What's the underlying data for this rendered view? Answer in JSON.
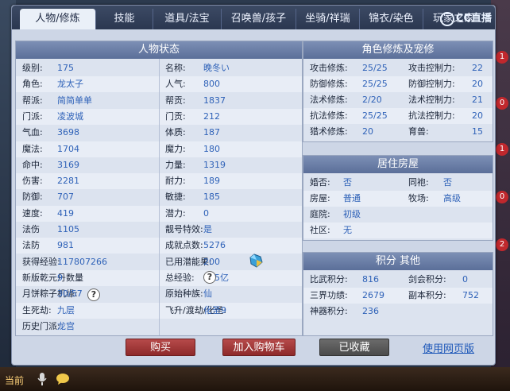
{
  "tabs": [
    "人物/修炼",
    "技能",
    "道具/法宝",
    "召唤兽/孩子",
    "坐骑/祥瑞",
    "锦衣/染色",
    "玩家之家"
  ],
  "logo": "CC直播",
  "char_status": {
    "title": "人物状态",
    "rows": [
      {
        "l1": "级别:",
        "v1": "175",
        "l2": "名称:",
        "v2": "晚冬い"
      },
      {
        "l1": "角色:",
        "v1": "龙太子",
        "l2": "人气:",
        "v2": "800"
      },
      {
        "l1": "帮派:",
        "v1": "简简单单",
        "l2": "帮贡:",
        "v2": "1837"
      },
      {
        "l1": "门派:",
        "v1": "凌波城",
        "l2": "门贡:",
        "v2": "212"
      },
      {
        "l1": "气血:",
        "v1": "3698",
        "l2": "体质:",
        "v2": "187"
      },
      {
        "l1": "魔法:",
        "v1": "1704",
        "l2": "魔力:",
        "v2": "180"
      },
      {
        "l1": "命中:",
        "v1": "3169",
        "l2": "力量:",
        "v2": "1319"
      },
      {
        "l1": "伤害:",
        "v1": "2281",
        "l2": "耐力:",
        "v2": "189"
      },
      {
        "l1": "防御:",
        "v1": "707",
        "l2": "敏捷:",
        "v2": "185"
      },
      {
        "l1": "速度:",
        "v1": "419",
        "l2": "潜力:",
        "v2": "0"
      },
      {
        "l1": "法伤",
        "v1": "1105",
        "l2": "靓号特效:",
        "v2": "是"
      },
      {
        "l1": "法防",
        "v1": "981",
        "l2": "成就点数:",
        "v2": "5276"
      },
      {
        "l1": "获得经验:",
        "v1": "117807266",
        "l2": "已用潜能果:",
        "v2": "200"
      },
      {
        "l1": "新版乾元丹数量",
        "v1": "9",
        "l2": "总经验:",
        "v2": "465亿"
      },
      {
        "l1": "月饼粽子机缘:",
        "v1": "30/57",
        "l2": "原始种族:",
        "v2": "仙"
      },
      {
        "l1": "生死劫:",
        "v1": "九层",
        "l2": "飞升/渡劫/化圣:",
        "v2": "化圣9"
      },
      {
        "l1": "历史门派:",
        "v1": "龙宫",
        "l2": "",
        "v2": ""
      }
    ]
  },
  "cultivation": {
    "title": "角色修炼及宠修",
    "rows": [
      {
        "l1": "攻击修炼:",
        "v1": "25/25",
        "l2": "攻击控制力:",
        "v2": "22"
      },
      {
        "l1": "防御修炼:",
        "v1": "25/25",
        "l2": "防御控制力:",
        "v2": "20"
      },
      {
        "l1": "法术修炼:",
        "v1": "2/20",
        "l2": "法术控制力:",
        "v2": "21"
      },
      {
        "l1": "抗法修炼:",
        "v1": "25/25",
        "l2": "抗法控制力:",
        "v2": "20"
      },
      {
        "l1": "猎术修炼:",
        "v1": "20",
        "l2": "育兽:",
        "v2": "15"
      }
    ]
  },
  "house": {
    "title": "居住房屋",
    "rows": [
      {
        "l1": "婚否:",
        "v1": "否",
        "l2": "同袍:",
        "v2": "否"
      },
      {
        "l1": "房屋:",
        "v1": "普通",
        "l2": "牧场:",
        "v2": "高级"
      },
      {
        "l1": "庭院:",
        "v1": "初级",
        "l2": "",
        "v2": ""
      },
      {
        "l1": "社区:",
        "v1": "无",
        "l2": "",
        "v2": ""
      }
    ]
  },
  "points": {
    "title": "积分 其他",
    "rows": [
      {
        "l1": "比武积分:",
        "v1": "816",
        "l2": "剑会积分:",
        "v2": "0"
      },
      {
        "l1": "三界功绩:",
        "v1": "2679",
        "l2": "副本积分:",
        "v2": "752"
      },
      {
        "l1": "神器积分:",
        "v1": "236",
        "l2": "",
        "v2": ""
      }
    ]
  },
  "buttons": {
    "buy": "购买",
    "cart": "加入购物车",
    "fav": "已收藏",
    "web": "使用网页版"
  },
  "bottom": {
    "current": "当前"
  },
  "badges": [
    "1",
    "0",
    "1",
    "0",
    "2"
  ],
  "help_glyph": "?"
}
